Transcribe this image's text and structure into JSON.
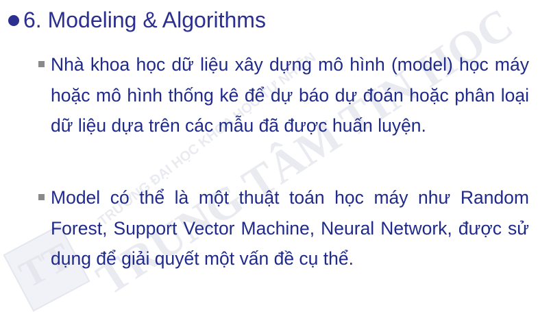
{
  "slide": {
    "heading": {
      "number_title": "6. Modeling & Algorithms"
    },
    "bullets": [
      {
        "text": "Nhà khoa học dữ liệu xây dựng mô hình (model) học máy hoặc mô hình thống kê để dự báo dự đoán hoặc phân loại dữ liệu dựa trên các mẫu đã được huấn luyện."
      },
      {
        "text": "Model có thể là một thuật toán học máy như Random Forest, Support Vector Machine, Neural Network, được sử dụng để giải quyết một vấn đề cụ thể."
      }
    ],
    "watermark": {
      "text_line1": "TRƯỜNG ĐẠI HỌC KHOA HỌC TỰ NHIÊN",
      "text_line2": "TRUNG TÂM TIN HỌC",
      "logo_letters": "TT"
    },
    "colors": {
      "heading": "#2b2f8f",
      "body_text": "#1f2a8a",
      "bullet_marker": "#8a8a8a",
      "watermark": "#d9dbe6"
    }
  }
}
